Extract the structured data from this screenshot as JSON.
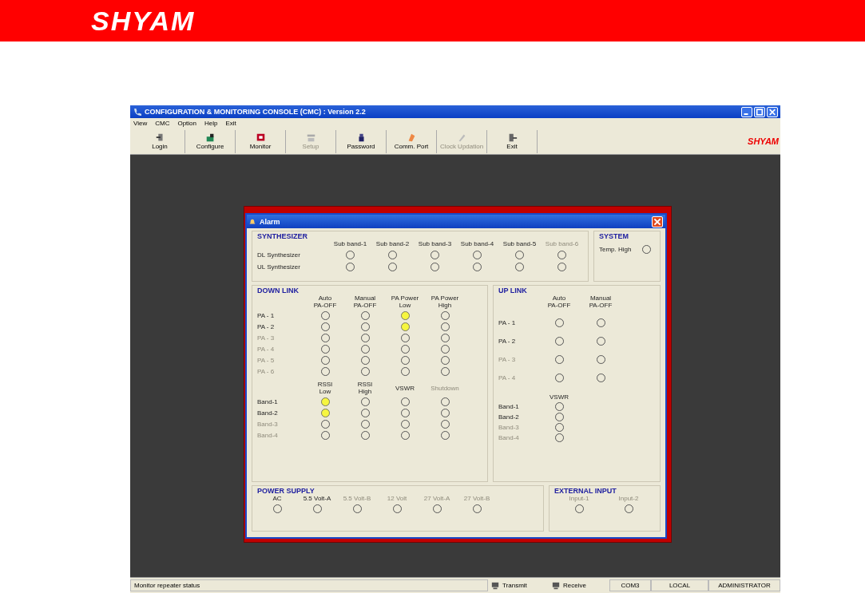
{
  "banner": {
    "logo": "SHYAM"
  },
  "window": {
    "title": "CONFIGURATION & MONITORING CONSOLE (CMC)  :  Version 2.2"
  },
  "menu": [
    "View",
    "CMC",
    "Option",
    "Help",
    "Exit"
  ],
  "toolbar": [
    {
      "label": "Login",
      "disabled": false
    },
    {
      "label": "Configure",
      "disabled": false
    },
    {
      "label": "Monitor",
      "disabled": false
    },
    {
      "label": "Setup",
      "disabled": true
    },
    {
      "label": "Password",
      "disabled": false
    },
    {
      "label": "Comm. Port",
      "disabled": false
    },
    {
      "label": "Clock Updation",
      "disabled": true
    },
    {
      "label": "Exit",
      "disabled": false
    }
  ],
  "brand": "SHYAM",
  "dialog": {
    "title": "Alarm",
    "synthesizer": {
      "title": "SYNTHESIZER",
      "columns": [
        {
          "label": "Sub band-1",
          "disabled": false
        },
        {
          "label": "Sub band-2",
          "disabled": false
        },
        {
          "label": "Sub band-3",
          "disabled": false
        },
        {
          "label": "Sub band-4",
          "disabled": false
        },
        {
          "label": "Sub band-5",
          "disabled": false
        },
        {
          "label": "Sub band-6",
          "disabled": true
        }
      ],
      "rows": [
        {
          "label": "DL Synthesizer",
          "disabled": false,
          "lit": [
            false,
            false,
            false,
            false,
            false,
            false
          ]
        },
        {
          "label": "UL Synthesizer",
          "disabled": false,
          "lit": [
            false,
            false,
            false,
            false,
            false,
            false
          ]
        }
      ]
    },
    "system": {
      "title": "SYSTEM",
      "rows": [
        {
          "label": "Temp. High",
          "disabled": false,
          "lit": [
            false
          ]
        }
      ]
    },
    "down_link": {
      "title": "DOWN LINK",
      "groups": [
        {
          "columns": [
            {
              "label": "Auto\nPA-OFF",
              "disabled": false
            },
            {
              "label": "Manual\nPA-OFF",
              "disabled": false
            },
            {
              "label": "PA Power\nLow",
              "disabled": false
            },
            {
              "label": "PA Power\nHigh",
              "disabled": false
            }
          ],
          "rows": [
            {
              "label": "PA - 1",
              "disabled": false,
              "lit": [
                false,
                false,
                true,
                false
              ]
            },
            {
              "label": "PA - 2",
              "disabled": false,
              "lit": [
                false,
                false,
                true,
                false
              ]
            },
            {
              "label": "PA - 3",
              "disabled": true,
              "lit": [
                false,
                false,
                false,
                false
              ]
            },
            {
              "label": "PA - 4",
              "disabled": true,
              "lit": [
                false,
                false,
                false,
                false
              ]
            },
            {
              "label": "PA - 5",
              "disabled": true,
              "lit": [
                false,
                false,
                false,
                false
              ]
            },
            {
              "label": "PA - 6",
              "disabled": true,
              "lit": [
                false,
                false,
                false,
                false
              ]
            }
          ]
        },
        {
          "columns": [
            {
              "label": "RSSI\nLow",
              "disabled": false
            },
            {
              "label": "RSSI\nHigh",
              "disabled": false
            },
            {
              "label": "VSWR",
              "disabled": false
            },
            {
              "label": "Shutdown",
              "disabled": true
            }
          ],
          "rows": [
            {
              "label": "Band-1",
              "disabled": false,
              "lit": [
                true,
                false,
                false,
                false
              ]
            },
            {
              "label": "Band-2",
              "disabled": false,
              "lit": [
                true,
                false,
                false,
                false
              ]
            },
            {
              "label": "Band-3",
              "disabled": true,
              "lit": [
                false,
                false,
                false,
                false
              ]
            },
            {
              "label": "Band-4",
              "disabled": true,
              "lit": [
                false,
                false,
                false,
                false
              ]
            }
          ]
        }
      ]
    },
    "up_link": {
      "title": "UP LINK",
      "groups": [
        {
          "columns": [
            {
              "label": "Auto\nPA-OFF",
              "disabled": false
            },
            {
              "label": "Manual\nPA-OFF",
              "disabled": false
            }
          ],
          "rows": [
            {
              "label": "PA - 1",
              "disabled": false,
              "lit": [
                false,
                false
              ]
            },
            {
              "label": "PA - 2",
              "disabled": false,
              "lit": [
                false,
                false
              ]
            },
            {
              "label": "PA - 3",
              "disabled": true,
              "lit": [
                false,
                false
              ]
            },
            {
              "label": "PA - 4",
              "disabled": true,
              "lit": [
                false,
                false
              ]
            }
          ]
        },
        {
          "columns": [
            {
              "label": "VSWR",
              "disabled": false
            }
          ],
          "rows": [
            {
              "label": "Band-1",
              "disabled": false,
              "lit": [
                false
              ]
            },
            {
              "label": "Band-2",
              "disabled": false,
              "lit": [
                false
              ]
            },
            {
              "label": "Band-3",
              "disabled": true,
              "lit": [
                false
              ]
            },
            {
              "label": "Band-4",
              "disabled": true,
              "lit": [
                false
              ]
            }
          ]
        }
      ]
    },
    "power_supply": {
      "title": "POWER SUPPLY",
      "items": [
        {
          "label": "AC",
          "disabled": false,
          "lit": false
        },
        {
          "label": "5.5 Volt-A",
          "disabled": false,
          "lit": false
        },
        {
          "label": "5.5 Volt-B",
          "disabled": true,
          "lit": false
        },
        {
          "label": "12 Volt",
          "disabled": true,
          "lit": false
        },
        {
          "label": "27 Volt-A",
          "disabled": true,
          "lit": false
        },
        {
          "label": "27 Volt-B",
          "disabled": true,
          "lit": false
        }
      ]
    },
    "external_input": {
      "title": "EXTERNAL INPUT",
      "items": [
        {
          "label": "Input-1",
          "disabled": true,
          "lit": false
        },
        {
          "label": "Input-2",
          "disabled": true,
          "lit": false
        }
      ]
    }
  },
  "status_bar": {
    "message": "Monitor repeater status",
    "transmit": "Transmit",
    "receive": "Receive",
    "port": "COM3",
    "mode": "LOCAL",
    "user": "ADMINISTRATOR"
  }
}
